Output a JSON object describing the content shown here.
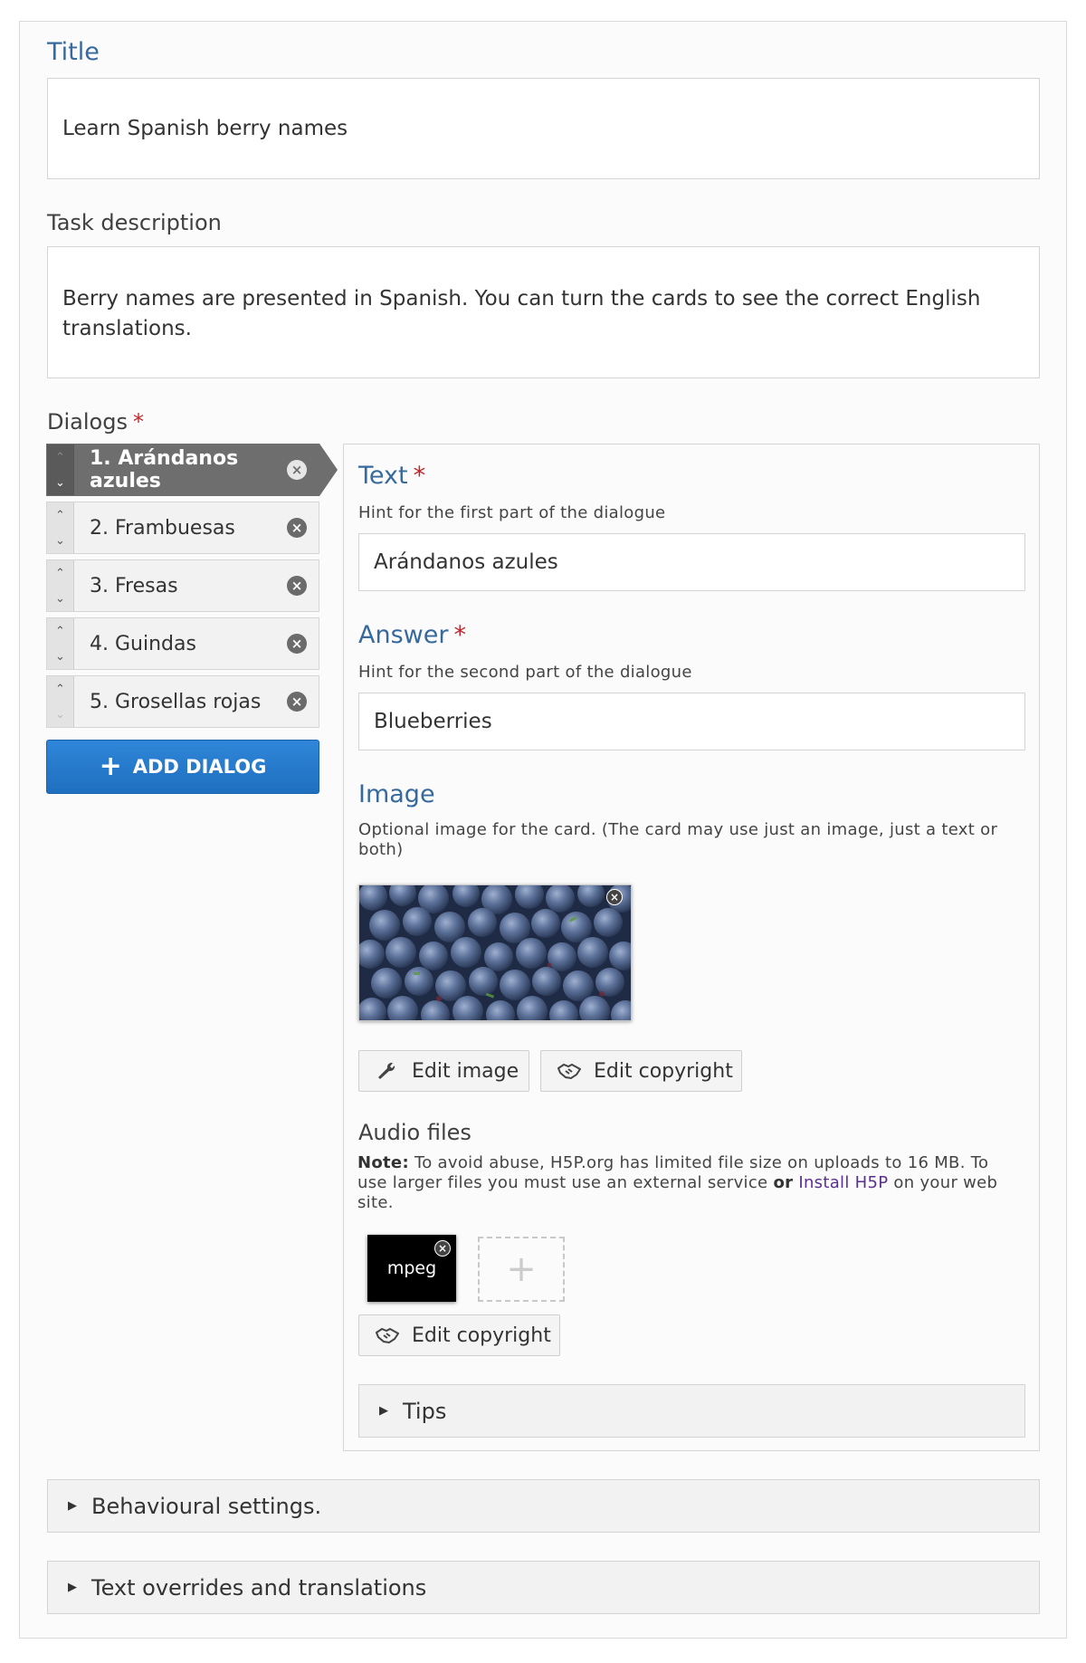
{
  "title_field": {
    "label": "Title",
    "value": "Learn Spanish berry names"
  },
  "task_description": {
    "label": "Task description",
    "value": "Berry names are presented in Spanish. You can turn the cards to see the correct English translations."
  },
  "dialogs": {
    "label": "Dialogs",
    "required_mark": "*",
    "items": [
      {
        "label": "1. Arándanos azules"
      },
      {
        "label": "2. Frambuesas"
      },
      {
        "label": "3. Fresas"
      },
      {
        "label": "4. Guindas"
      },
      {
        "label": "5. Grosellas rojas"
      }
    ],
    "add_button": "ADD DIALOG",
    "active_index": 0
  },
  "editor": {
    "text": {
      "label": "Text",
      "required_mark": "*",
      "hint": "Hint for the first part of the dialogue",
      "value": "Arándanos azules"
    },
    "answer": {
      "label": "Answer",
      "required_mark": "*",
      "hint": "Hint for the second part of the dialogue",
      "value": "Blueberries"
    },
    "image": {
      "label": "Image",
      "hint": "Optional image for the card. (The card may use just an image, just a text or both)",
      "edit_image_button": "Edit image",
      "edit_copyright_button": "Edit copyright"
    },
    "audio": {
      "label": "Audio files",
      "note_bold": "Note:",
      "note_text_1": " To avoid abuse, H5P.org has limited file size on uploads to 16 MB. To use larger files you must use an external service ",
      "note_or": "or",
      "note_link": "Install H5P",
      "note_text_2": " on your web site.",
      "file_type": "mpeg",
      "edit_copyright_button": "Edit copyright"
    },
    "tips_label": "Tips"
  },
  "behavioural_settings_label": "Behavioural settings.",
  "text_overrides_label": "Text overrides and translations",
  "colors": {
    "accent_blue": "#36699d",
    "button_blue": "#1f6fc0",
    "required_red": "#c0272d",
    "link_purple": "#5b2e91"
  }
}
